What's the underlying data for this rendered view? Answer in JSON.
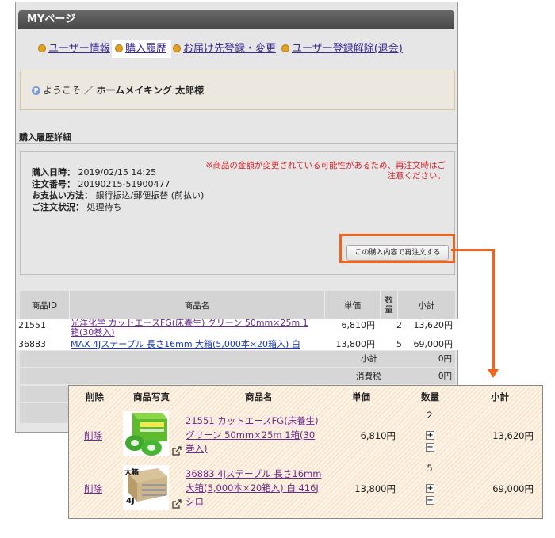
{
  "header": {
    "title": "MYページ"
  },
  "nav": [
    {
      "label": "ユーザー情報",
      "active": false
    },
    {
      "label": "購入履歴",
      "active": true
    },
    {
      "label": "お届け先登録・変更",
      "active": false
    },
    {
      "label": "ユーザー登録解除(退会)",
      "active": false
    }
  ],
  "welcome": {
    "icon_glyph": "P",
    "prefix": "ようこそ ／ ",
    "name": "ホームメイキング 太郎様"
  },
  "section": {
    "title": "購入履歴詳細"
  },
  "order": {
    "date_label": "購入日時：",
    "date_value": "2019/02/15 14:25",
    "number_label": "注文番号：",
    "number_value": "20190215-51900477",
    "payment_label": "お支払い方法：",
    "payment_value": "銀行振込/郵便振替 (前払い)",
    "status_label": "ご注文状況：",
    "status_value": "処理待ち",
    "notice": "※商品の金額が変更されている可能性があるため、再注文時はご注意ください。",
    "reorder_button": "この購入内容で再注文する"
  },
  "table": {
    "headers": {
      "id": "商品ID",
      "name": "商品名",
      "price": "単価",
      "qty": "数量",
      "subtotal": "小計"
    },
    "rows": [
      {
        "id": "21551",
        "name": "光洋化学 カットエースFG(床養生) グリーン 50mm×25m 1箱(30巻入)",
        "price": "6,810円",
        "qty": "2",
        "subtotal": "13,620円"
      },
      {
        "id": "36883",
        "name": "MAX 4Jステープル 長さ16mm 大箱(5,000本×20箱入) 白",
        "price": "13,800円",
        "qty": "5",
        "subtotal": "69,000円"
      }
    ],
    "summary": [
      {
        "label": "小計",
        "value": "0円"
      },
      {
        "label": "消費税",
        "value": "0円"
      }
    ]
  },
  "cart": {
    "headers": {
      "delete": "削除",
      "photo": "商品写真",
      "name": "商品名",
      "price": "単価",
      "qty": "数量",
      "subtotal": "小計"
    },
    "rows": [
      {
        "delete": "削除",
        "name": "21551 カットエースFG(床養生) グリーン 50mm×25m 1箱(30巻入)",
        "price": "6,810円",
        "qty": "2",
        "subtotal": "13,620円",
        "badge": ""
      },
      {
        "delete": "削除",
        "name": "36883 4Jステープル 長さ16mm 大箱(5,000本×20箱入) 白 416Jシロ",
        "price": "13,800円",
        "qty": "5",
        "subtotal": "69,000円",
        "badge": "大箱",
        "product_label": "4J"
      }
    ],
    "plus": "+",
    "minus": "−"
  },
  "colors": {
    "accent": "#f0641e",
    "header_bg": "#555555",
    "notice": "#d2232a",
    "link": "#6a2c8c",
    "panel_bg": "#fff3e6"
  },
  "icons": [
    "bullet-icon",
    "point-icon",
    "external-link-icon",
    "plus-icon",
    "minus-icon"
  ]
}
